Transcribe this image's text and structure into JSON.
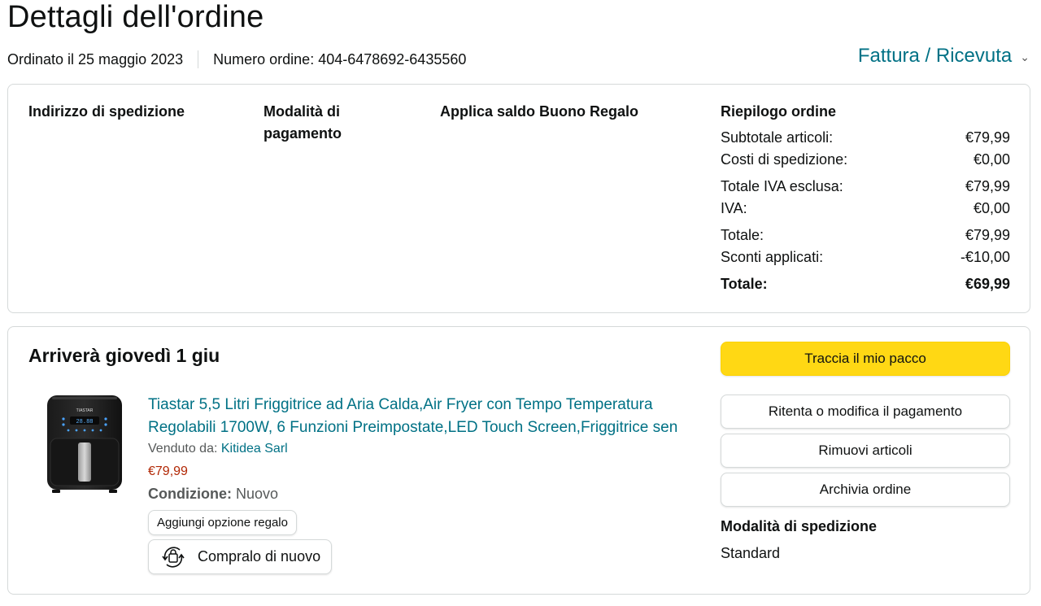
{
  "header": {
    "title": "Dettagli dell'ordine",
    "order_date": "Ordinato il 25 maggio 2023",
    "order_number": "Numero ordine: 404-6478692-6435560",
    "invoice_link": "Fattura / Ricevuta"
  },
  "summary_box": {
    "shipping_address_label": "Indirizzo di spedizione",
    "payment_method_label_line1": "Modalità di",
    "payment_method_label_line2": "pagamento",
    "gift_balance_label": "Applica saldo Buono Regalo",
    "order_summary_label": "Riepilogo ordine",
    "rows": [
      {
        "label": "Subtotale articoli:",
        "value": "€79,99"
      },
      {
        "label": "Costi di spedizione:",
        "value": "€0,00"
      },
      {
        "label": "Totale IVA esclusa:",
        "value": "€79,99"
      },
      {
        "label": "IVA:",
        "value": "€0,00"
      },
      {
        "label": "Totale:",
        "value": "€79,99"
      },
      {
        "label": "Sconti applicati:",
        "value": "-€10,00"
      },
      {
        "label": "Totale:",
        "value": "€69,99"
      }
    ]
  },
  "shipment": {
    "arrival": "Arriverà giovedì 1 giu",
    "product": {
      "title": "Tiastar 5,5 Litri Friggitrice ad Aria Calda,Air Fryer con Tempo Temperatura Regolabili 1700W, 6 Funzioni Preimpostate,LED Touch Screen,Friggitrice sen",
      "sold_by_label": "Venduto da:",
      "seller": "Kitidea Sarl",
      "price": "€79,99",
      "condition_label": "Condizione:",
      "condition_value": "Nuovo",
      "brand_on_image": "TIASTAR",
      "display_on_image": "28.88",
      "image_icon": "air-fryer-image"
    },
    "gift_option_button": "Aggiungi opzione regalo",
    "buy_again_button": "Compralo di nuovo",
    "buy_again_icon": "rebuy-icon",
    "actions": {
      "track": "Traccia il mio pacco",
      "retry_payment": "Ritenta o modifica il pagamento",
      "remove_items": "Rimuovi articoli",
      "archive": "Archivia ordine"
    },
    "shipping_mode_label": "Modalità di spedizione",
    "shipping_mode_value": "Standard"
  },
  "colors": {
    "link": "#007185",
    "price": "#B12704",
    "primary_button": "#FFD814",
    "border": "#D5D9D9",
    "text": "#0F1111"
  }
}
